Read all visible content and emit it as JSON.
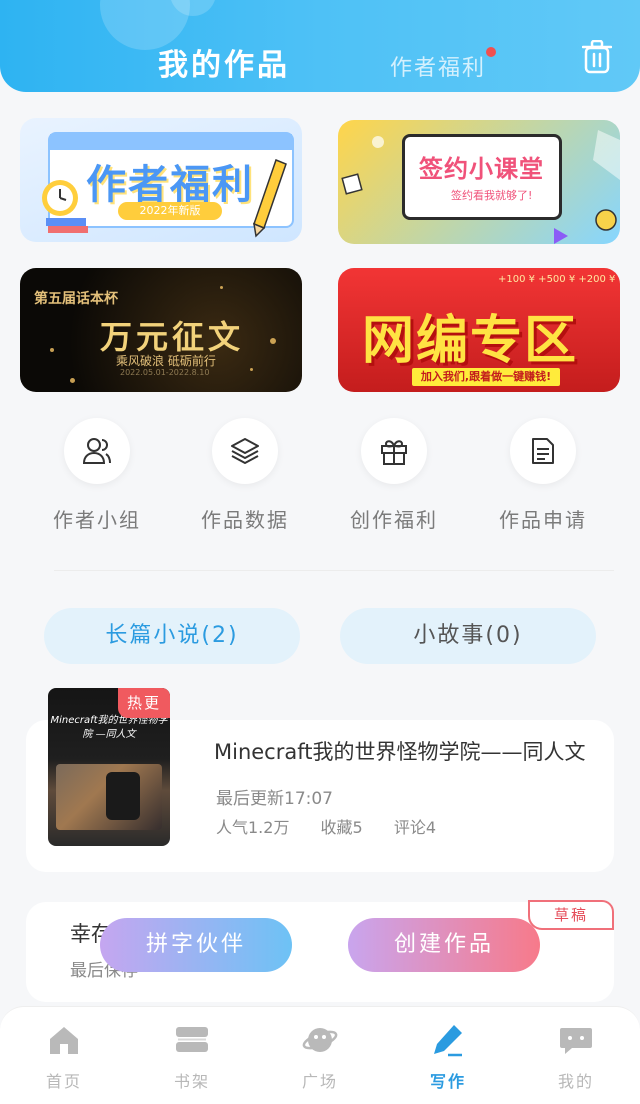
{
  "header": {
    "title": "我的作品",
    "subtitle": "作者福利",
    "trash_icon": "trash-icon"
  },
  "banners": [
    {
      "name": "作者福利",
      "text": "作者福利",
      "sub": "2022年新版"
    },
    {
      "name": "签约小课堂",
      "text": "签约小课堂",
      "sub": "签约看我就够了!"
    },
    {
      "name": "万元征文",
      "line1": "第五届话本杯",
      "text": "万元征文",
      "sub": "乘风破浪 砥砺前行",
      "date": "2022.05.01-2022.8.10"
    },
    {
      "name": "网编专区",
      "text": "网编专区",
      "sub": "加入我们,跟着做一键赚钱!",
      "coins": "+100 ¥  +500 ¥  +200 ¥"
    }
  ],
  "quick_actions": [
    {
      "label": "作者小组",
      "icon": "users-icon"
    },
    {
      "label": "作品数据",
      "icon": "layers-icon"
    },
    {
      "label": "创作福利",
      "icon": "gift-icon"
    },
    {
      "label": "作品申请",
      "icon": "document-icon"
    }
  ],
  "tabs": [
    {
      "label": "长篇小说(2)",
      "active": true
    },
    {
      "label": "小故事(0)",
      "active": false
    }
  ],
  "works": [
    {
      "badge": "热更",
      "cover_text": "Minecraft我的世界怪物学院 —同人文",
      "title": "Minecraft我的世界怪物学院——同人文",
      "update": "最后更新17:07",
      "popularity": "人气1.2万",
      "favorites": "收藏5",
      "comments": "评论4"
    },
    {
      "badge": "草稿",
      "title": "幸存",
      "update": "最后保存"
    }
  ],
  "fabs": {
    "partner": "拼字伙伴",
    "create": "创建作品"
  },
  "nav": [
    {
      "label": "首页",
      "icon": "home-icon"
    },
    {
      "label": "书架",
      "icon": "bookshelf-icon"
    },
    {
      "label": "广场",
      "icon": "planet-icon"
    },
    {
      "label": "写作",
      "icon": "pen-icon",
      "active": true
    },
    {
      "label": "我的",
      "icon": "chat-icon"
    }
  ],
  "colors": {
    "accent": "#2b9be0",
    "header": "#4ec1f6",
    "badge_red": "#f05a5f"
  }
}
